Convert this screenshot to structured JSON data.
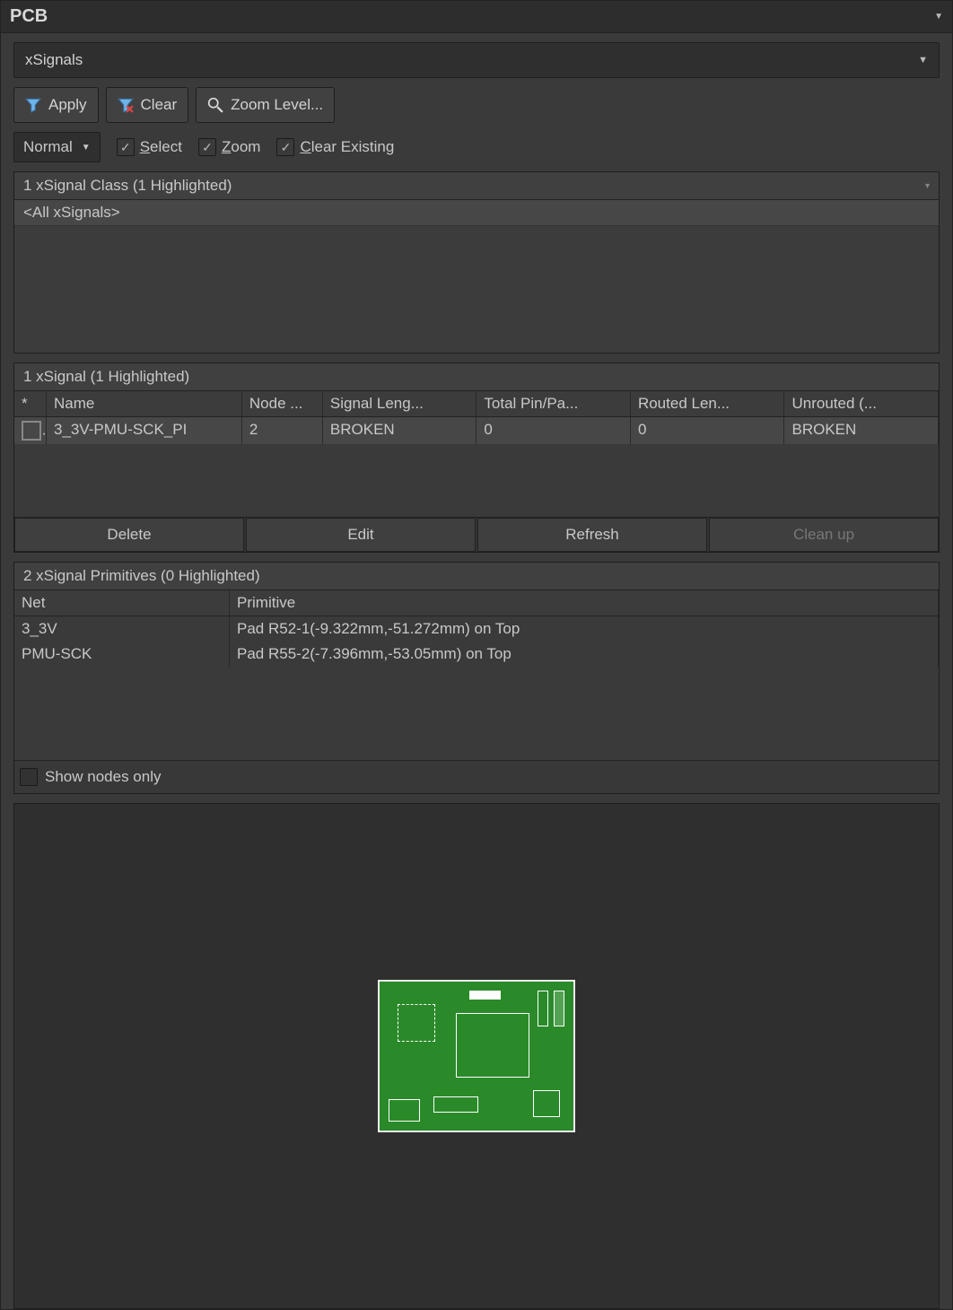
{
  "panel": {
    "title": "PCB"
  },
  "filter": {
    "dropdown_value": "xSignals",
    "apply": "Apply",
    "clear": "Clear",
    "zoom_level": "Zoom Level..."
  },
  "options": {
    "mode": "Normal",
    "select_label": "Select",
    "zoom_label": "Zoom",
    "clear_existing_label": "Clear Existing"
  },
  "class_section": {
    "header": "1 xSignal Class (1 Highlighted)",
    "items": [
      "<All xSignals>"
    ]
  },
  "signal_section": {
    "header": "1 xSignal (1 Highlighted)",
    "columns": {
      "star": "*",
      "name": "Name",
      "node": "Node ...",
      "signal_len": "Signal Leng...",
      "total_pin": "Total Pin/Pa...",
      "routed_len": "Routed Len...",
      "unrouted": "Unrouted (..."
    },
    "rows": [
      {
        "name": "3_3V-PMU-SCK_PI",
        "node": "2",
        "signal_len": "BROKEN",
        "total_pin": "0",
        "routed_len": "0",
        "unrouted": "BROKEN"
      }
    ],
    "buttons": {
      "delete": "Delete",
      "edit": "Edit",
      "refresh": "Refresh",
      "cleanup": "Clean up"
    }
  },
  "prim_section": {
    "header": "2 xSignal Primitives (0 Highlighted)",
    "columns": {
      "net": "Net",
      "primitive": "Primitive"
    },
    "rows": [
      {
        "net": "3_3V",
        "primitive": "Pad R52-1(-9.322mm,-51.272mm) on Top"
      },
      {
        "net": "PMU-SCK",
        "primitive": "Pad R55-2(-7.396mm,-53.05mm) on Top"
      }
    ],
    "show_nodes_label": "Show nodes only"
  }
}
